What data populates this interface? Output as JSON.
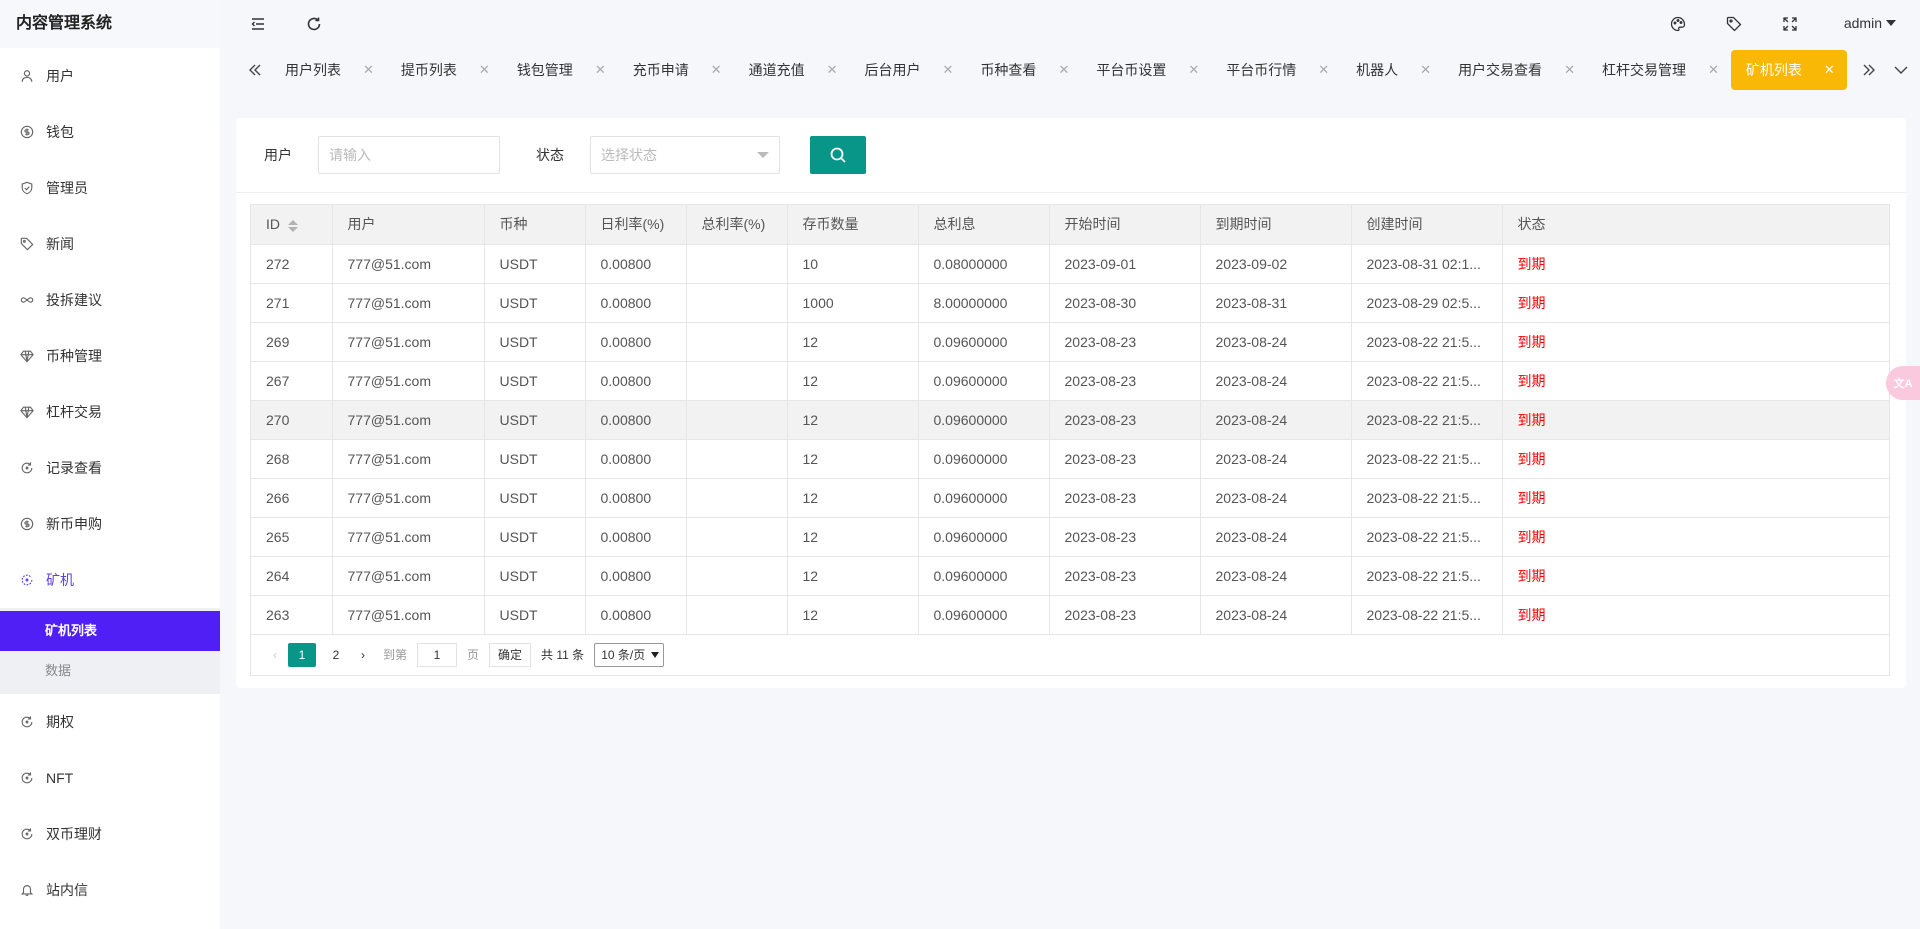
{
  "app": {
    "title": "内容管理系统"
  },
  "header": {
    "user": "admin"
  },
  "sidebar": {
    "items": [
      {
        "label": "用户",
        "icon": "user-icon"
      },
      {
        "label": "钱包",
        "icon": "dollar-icon"
      },
      {
        "label": "管理员",
        "icon": "shield-icon"
      },
      {
        "label": "新闻",
        "icon": "tag-icon"
      },
      {
        "label": "投拆建议",
        "icon": "infinity-icon"
      },
      {
        "label": "币种管理",
        "icon": "diamond-icon"
      },
      {
        "label": "杠杆交易",
        "icon": "diamond-icon"
      },
      {
        "label": "记录查看",
        "icon": "refresh-icon"
      },
      {
        "label": "新币申购",
        "icon": "dollar-icon"
      },
      {
        "label": "矿机",
        "icon": "loader-icon"
      }
    ],
    "sub_items": [
      {
        "label": "矿机列表"
      },
      {
        "label": "数据"
      }
    ],
    "items_after": [
      {
        "label": "期权",
        "icon": "refresh-icon"
      },
      {
        "label": "NFT",
        "icon": "refresh-icon"
      },
      {
        "label": "双币理财",
        "icon": "refresh-icon"
      },
      {
        "label": "站内信",
        "icon": "bell-icon"
      }
    ]
  },
  "tabs": [
    {
      "label": "用户列表"
    },
    {
      "label": "提币列表"
    },
    {
      "label": "钱包管理"
    },
    {
      "label": "充币申请"
    },
    {
      "label": "通道充值"
    },
    {
      "label": "后台用户"
    },
    {
      "label": "币种查看"
    },
    {
      "label": "平台币设置"
    },
    {
      "label": "平台币行情"
    },
    {
      "label": "机器人"
    },
    {
      "label": "用户交易查看"
    },
    {
      "label": "杠杆交易管理"
    },
    {
      "label": "矿机列表"
    }
  ],
  "filter": {
    "user_label": "用户",
    "user_placeholder": "请输入",
    "status_label": "状态",
    "status_placeholder": "选择状态"
  },
  "table": {
    "columns": [
      "ID",
      "用户",
      "币种",
      "日利率(%)",
      "总利率(%)",
      "存币数量",
      "总利息",
      "开始时间",
      "到期时间",
      "创建时间",
      "状态"
    ],
    "rows": [
      [
        "272",
        "777@51.com",
        "USDT",
        "0.00800",
        "",
        "10",
        "0.08000000",
        "2023-09-01",
        "2023-09-02",
        "2023-08-31 02:1...",
        "到期"
      ],
      [
        "271",
        "777@51.com",
        "USDT",
        "0.00800",
        "",
        "1000",
        "8.00000000",
        "2023-08-30",
        "2023-08-31",
        "2023-08-29 02:5...",
        "到期"
      ],
      [
        "269",
        "777@51.com",
        "USDT",
        "0.00800",
        "",
        "12",
        "0.09600000",
        "2023-08-23",
        "2023-08-24",
        "2023-08-22 21:5...",
        "到期"
      ],
      [
        "267",
        "777@51.com",
        "USDT",
        "0.00800",
        "",
        "12",
        "0.09600000",
        "2023-08-23",
        "2023-08-24",
        "2023-08-22 21:5...",
        "到期"
      ],
      [
        "270",
        "777@51.com",
        "USDT",
        "0.00800",
        "",
        "12",
        "0.09600000",
        "2023-08-23",
        "2023-08-24",
        "2023-08-22 21:5...",
        "到期"
      ],
      [
        "268",
        "777@51.com",
        "USDT",
        "0.00800",
        "",
        "12",
        "0.09600000",
        "2023-08-23",
        "2023-08-24",
        "2023-08-22 21:5...",
        "到期"
      ],
      [
        "266",
        "777@51.com",
        "USDT",
        "0.00800",
        "",
        "12",
        "0.09600000",
        "2023-08-23",
        "2023-08-24",
        "2023-08-22 21:5...",
        "到期"
      ],
      [
        "265",
        "777@51.com",
        "USDT",
        "0.00800",
        "",
        "12",
        "0.09600000",
        "2023-08-23",
        "2023-08-24",
        "2023-08-22 21:5...",
        "到期"
      ],
      [
        "264",
        "777@51.com",
        "USDT",
        "0.00800",
        "",
        "12",
        "0.09600000",
        "2023-08-23",
        "2023-08-24",
        "2023-08-22 21:5...",
        "到期"
      ],
      [
        "263",
        "777@51.com",
        "USDT",
        "0.00800",
        "",
        "12",
        "0.09600000",
        "2023-08-23",
        "2023-08-24",
        "2023-08-22 21:5...",
        "到期"
      ]
    ]
  },
  "pagination": {
    "pages": [
      "1",
      "2"
    ],
    "goto_label": "到第",
    "goto_value": "1",
    "page_label": "页",
    "confirm_label": "确定",
    "total_label": "共 11 条",
    "per_page": "10 条/页"
  },
  "colors": {
    "accent": "#4f1ff5",
    "tab_active": "#f9b806",
    "primary": "#079688",
    "status_expired": "#ff0000"
  }
}
